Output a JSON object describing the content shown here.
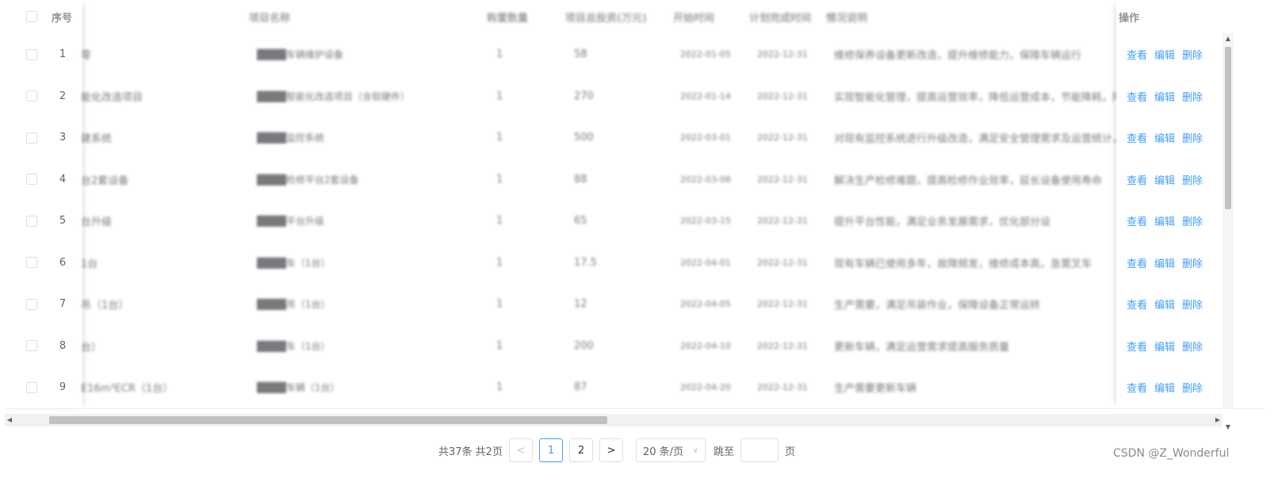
{
  "table": {
    "headers": {
      "index": "序号",
      "name": "项目名称",
      "qty": "购置数量",
      "budget": "项目总投资(万元)",
      "start": "开始时间",
      "finish": "计划完成时间",
      "desc": "情况说明",
      "actions": "操作"
    },
    "rows": [
      {
        "index": "1",
        "partial": "零",
        "name": "████车辆维护设备",
        "qty": "1",
        "budget": "58",
        "start": "2022-01-05",
        "finish": "2022-12-31",
        "desc": "维修保养设备更新改造，提升维修能力，保障车辆运行"
      },
      {
        "index": "2",
        "partial": "能化改造项目",
        "name": "████智能化改造项目（含软硬件）",
        "qty": "1",
        "budget": "270",
        "start": "2022-01-14",
        "finish": "2022-12-31",
        "desc": "实现智能化管理，提高运营效率，降低运营成本，节能降耗，降本"
      },
      {
        "index": "3",
        "partial": "建系统",
        "name": "████监控系统",
        "qty": "1",
        "budget": "500",
        "start": "2022-03-01",
        "finish": "2022-12-31",
        "desc": "对现有监控系统进行升级改造，满足安全管理需求及运营统计，纳"
      },
      {
        "index": "4",
        "partial": "台2套设备",
        "name": "████检修平台2套设备",
        "qty": "1",
        "budget": "88",
        "start": "2022-03-08",
        "finish": "2022-12-31",
        "desc": "解决生产检修难题，提高检修作业效率，延长设备使用寿命"
      },
      {
        "index": "5",
        "partial": "台升级",
        "name": "████平台升级",
        "qty": "1",
        "budget": "65",
        "start": "2022-03-15",
        "finish": "2022-12-31",
        "desc": "提升平台性能，满足业务发展需求，优化部分设"
      },
      {
        "index": "6",
        "partial": "1台",
        "name": "████车（1台）",
        "qty": "1",
        "budget": "17.5",
        "start": "2022-04-01",
        "finish": "2022-12-31",
        "desc": "现有车辆已使用多年，故障频发，维修成本高，急需叉车"
      },
      {
        "index": "7",
        "partial": "吊（1台）",
        "name": "████吊（1台）",
        "qty": "1",
        "budget": "12",
        "start": "2022-04-05",
        "finish": "2022-12-31",
        "desc": "生产需要，满足吊装作业，保障设备正常运转"
      },
      {
        "index": "8",
        "partial": "台）",
        "name": "████车（1台）",
        "qty": "1",
        "budget": "200",
        "start": "2022-04-10",
        "finish": "2022-12-31",
        "desc": "更新车辆，满足运营需求提高服务质量"
      },
      {
        "index": "9",
        "partial": "E16m³ECR（1台）",
        "name": "████车辆（1台）",
        "qty": "1",
        "budget": "87",
        "start": "2022-04-20",
        "finish": "2022-12-31",
        "desc": "生产需要更新车辆"
      }
    ],
    "actions": {
      "view": "查看",
      "edit": "编辑",
      "delete": "删除"
    }
  },
  "pagination": {
    "total_text": "共37条 共2页",
    "prev": "<",
    "pages": [
      "1",
      "2"
    ],
    "current": "1",
    "next": ">",
    "page_size": "20 条/页",
    "jump_label": "跳至",
    "page_suffix": "页",
    "jump_value": ""
  },
  "watermark": "CSDN @Z_Wonderful",
  "colors": {
    "accent": "#409eff",
    "border": "#ebeef5"
  }
}
